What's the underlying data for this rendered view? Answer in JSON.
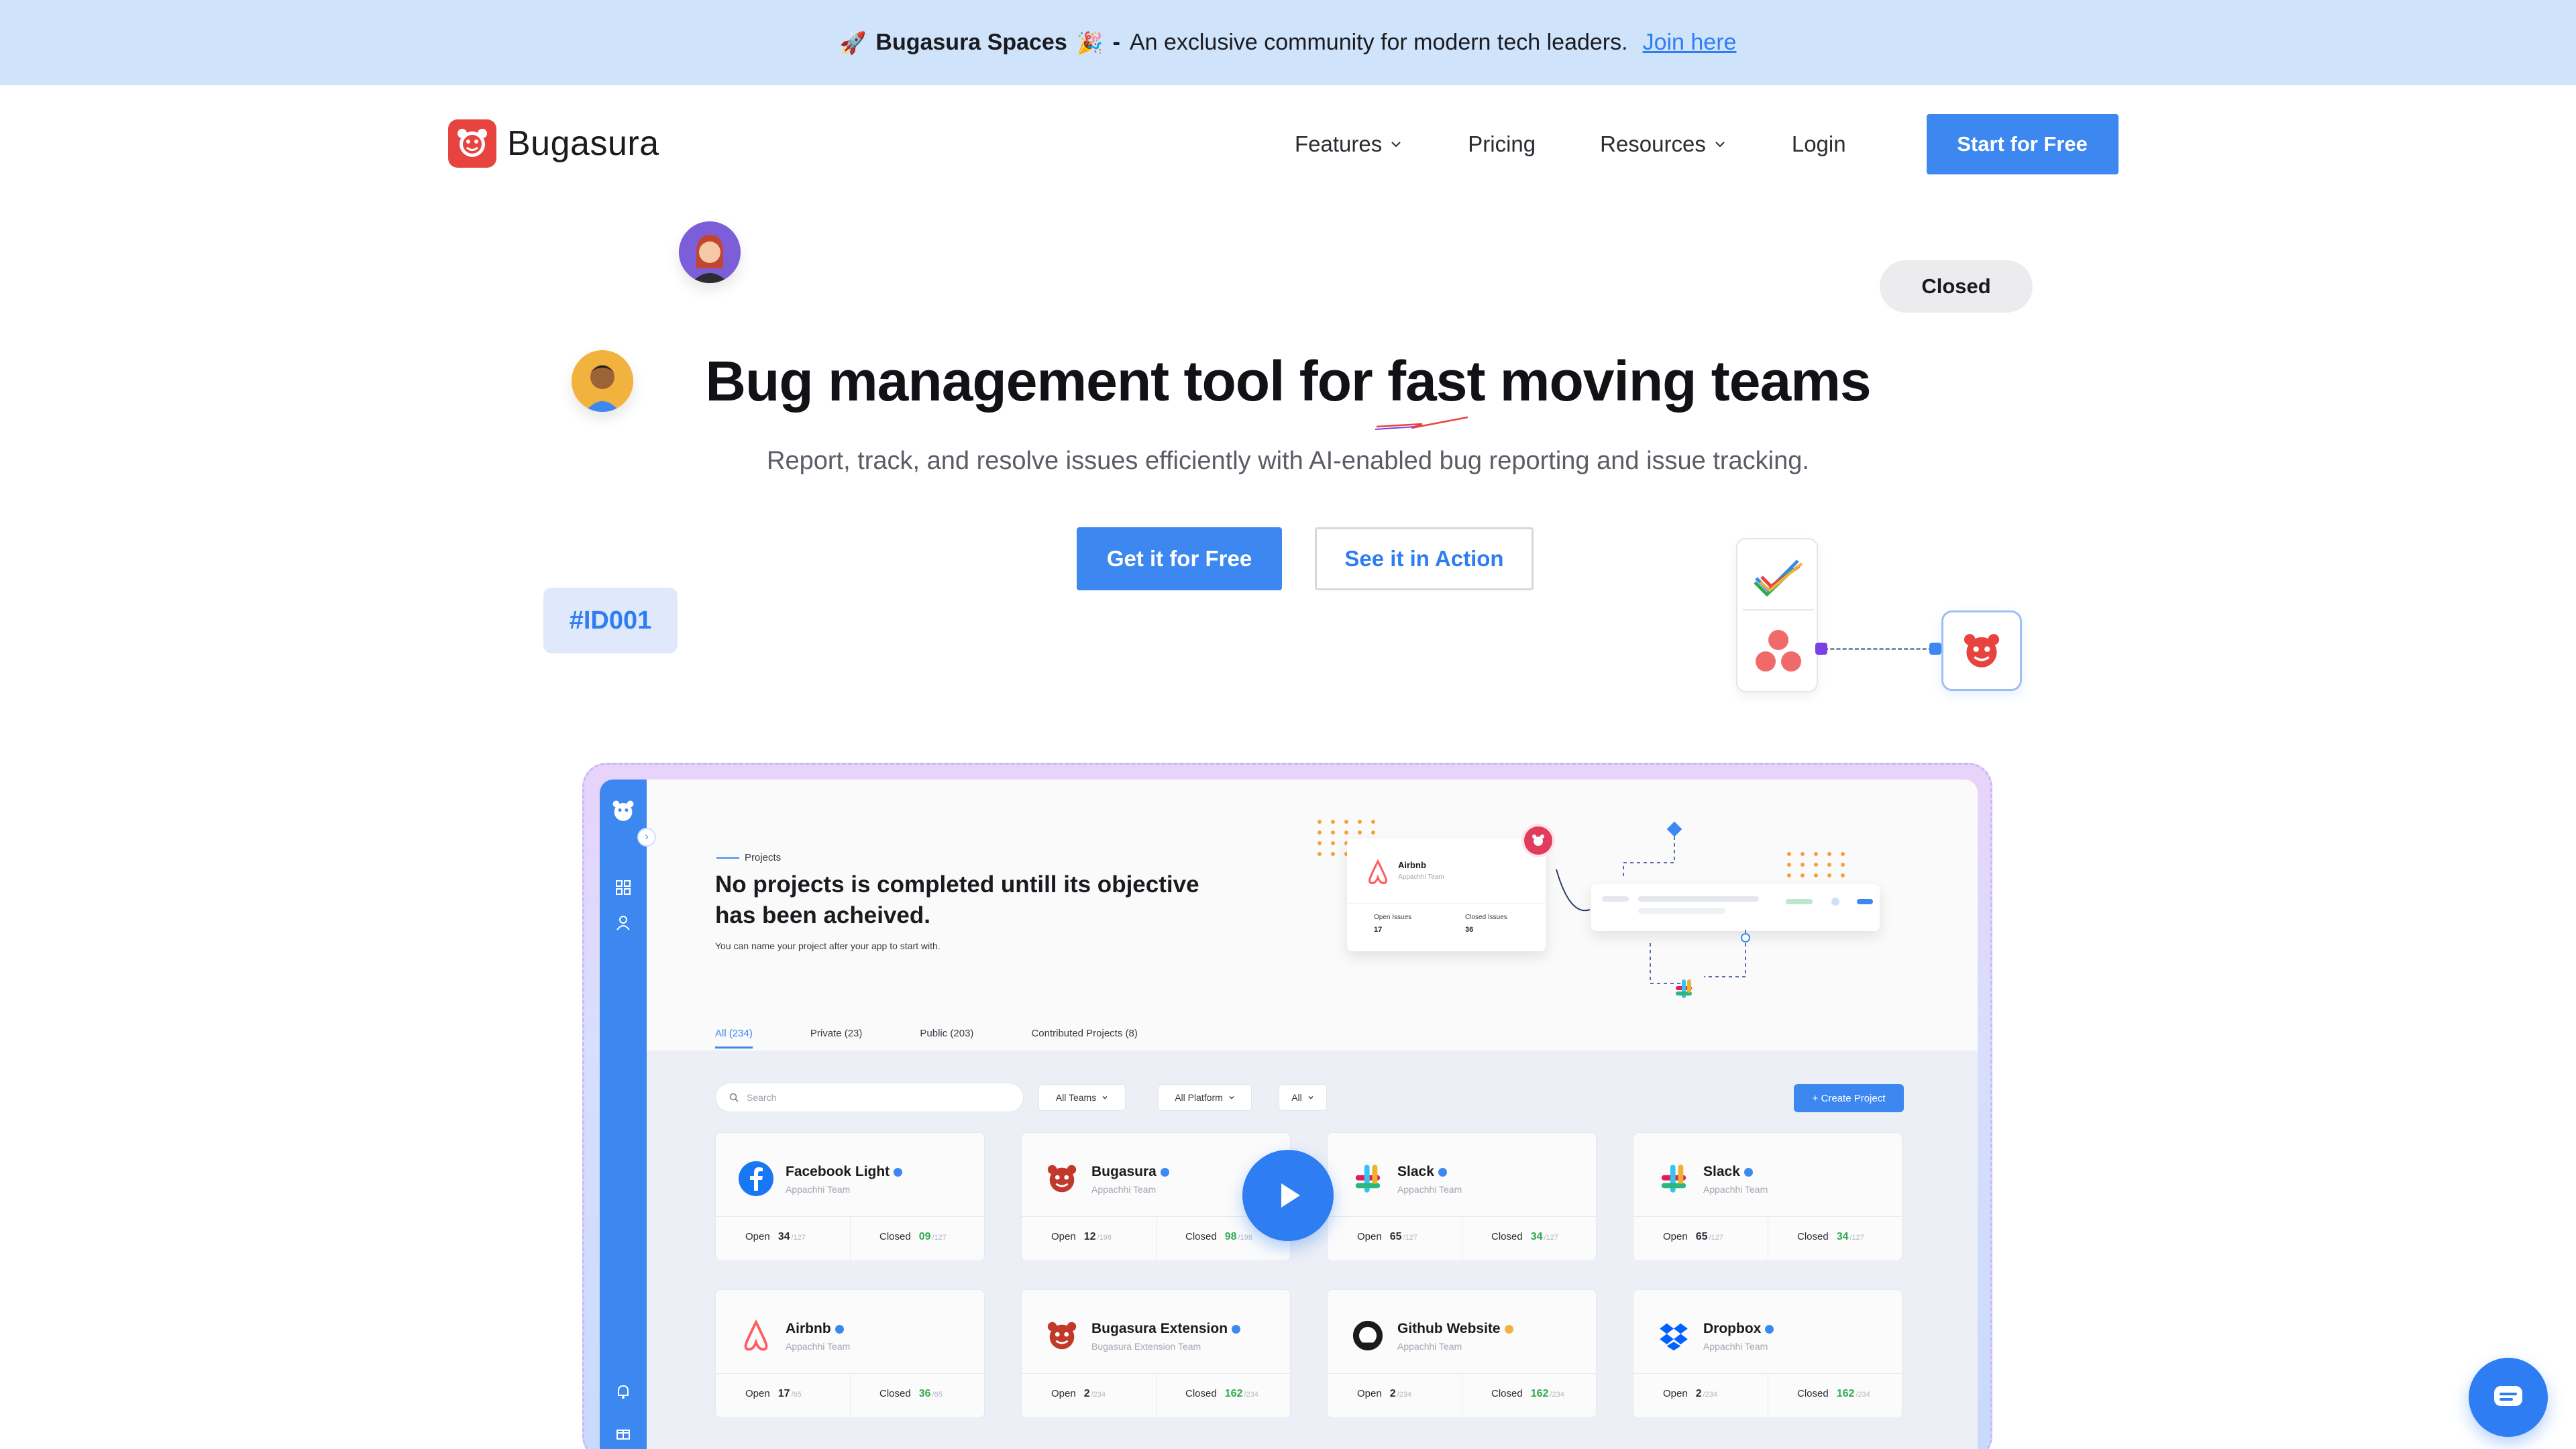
{
  "banner": {
    "emoji_left": "🚀",
    "brand": "Bugasura Spaces",
    "emoji_right": "🎉",
    "dash": "-",
    "text": "An exclusive community for modern tech leaders.",
    "link": "Join here"
  },
  "nav": {
    "logo_text": "Bugasura",
    "items": [
      "Features",
      "Pricing",
      "Resources",
      "Login"
    ],
    "cta": "Start for Free"
  },
  "hero": {
    "badge_closed": "Closed",
    "tag_id": "#ID001",
    "title": "Bug management tool for fast moving teams",
    "subtitle": "Report, track, and resolve issues efficiently with AI-enabled bug reporting and issue tracking.",
    "btn_primary": "Get it for Free",
    "btn_secondary": "See it in Action"
  },
  "app": {
    "section_label": "Projects",
    "headline": "No projects is completed untill its objective has been acheived.",
    "hint": "You can name your project after your app to start with.",
    "tabs": [
      "All (234)",
      "Private (23)",
      "Public (203)",
      "Contributed Projects (8)"
    ],
    "search_placeholder": "Search",
    "filters": [
      "All Teams",
      "All Platform",
      "All"
    ],
    "create_button": "+ Create Project",
    "mini_card": {
      "name": "Airbnb",
      "team": "Appachhi Team",
      "open_label": "Open Issues",
      "open_val": "17",
      "closed_label": "Closed Issues",
      "closed_val": "36"
    },
    "cards": [
      {
        "name": "Facebook Light",
        "team": "Appachhi Team",
        "open_label": "Open",
        "open": "34",
        "open_total": "/127",
        "closed_label": "Closed",
        "closed": "09",
        "closed_total": "/127"
      },
      {
        "name": "Bugasura",
        "team": "Appachhi Team",
        "open_label": "Open",
        "open": "12",
        "open_total": "/198",
        "closed_label": "Closed",
        "closed": "98",
        "closed_total": "/198"
      },
      {
        "name": "Slack",
        "team": "Appachhi Team",
        "open_label": "Open",
        "open": "65",
        "open_total": "/127",
        "closed_label": "Closed",
        "closed": "34",
        "closed_total": "/127"
      },
      {
        "name": "Slack",
        "team": "Appachhi Team",
        "open_label": "Open",
        "open": "65",
        "open_total": "/127",
        "closed_label": "Closed",
        "closed": "34",
        "closed_total": "/127"
      },
      {
        "name": "Airbnb",
        "team": "Appachhi Team",
        "open_label": "Open",
        "open": "17",
        "open_total": "/65",
        "closed_label": "Closed",
        "closed": "36",
        "closed_total": "/65"
      },
      {
        "name": "Bugasura Extension",
        "team": "Bugasura Extension Team",
        "open_label": "Open",
        "open": "2",
        "open_total": "/234",
        "closed_label": "Closed",
        "closed": "162",
        "closed_total": "/234"
      },
      {
        "name": "Github Website",
        "team": "Appachhi Team",
        "open_label": "Open",
        "open": "2",
        "open_total": "/234",
        "closed_label": "Closed",
        "closed": "162",
        "closed_total": "/234"
      },
      {
        "name": "Dropbox",
        "team": "Appachhi Team",
        "open_label": "Open",
        "open": "2",
        "open_total": "/234",
        "closed_label": "Closed",
        "closed": "162",
        "closed_total": "/234"
      }
    ]
  },
  "colors": {
    "primary": "#3d88f0",
    "banner_bg": "#cfe3fb",
    "brand_red": "#e8443f",
    "success": "#2eaa4f"
  },
  "icons": [
    "bugasura-logo-icon",
    "chevron-down-icon",
    "play-icon",
    "chat-icon",
    "search-icon",
    "asana-icon",
    "checkmark-app-icon"
  ]
}
